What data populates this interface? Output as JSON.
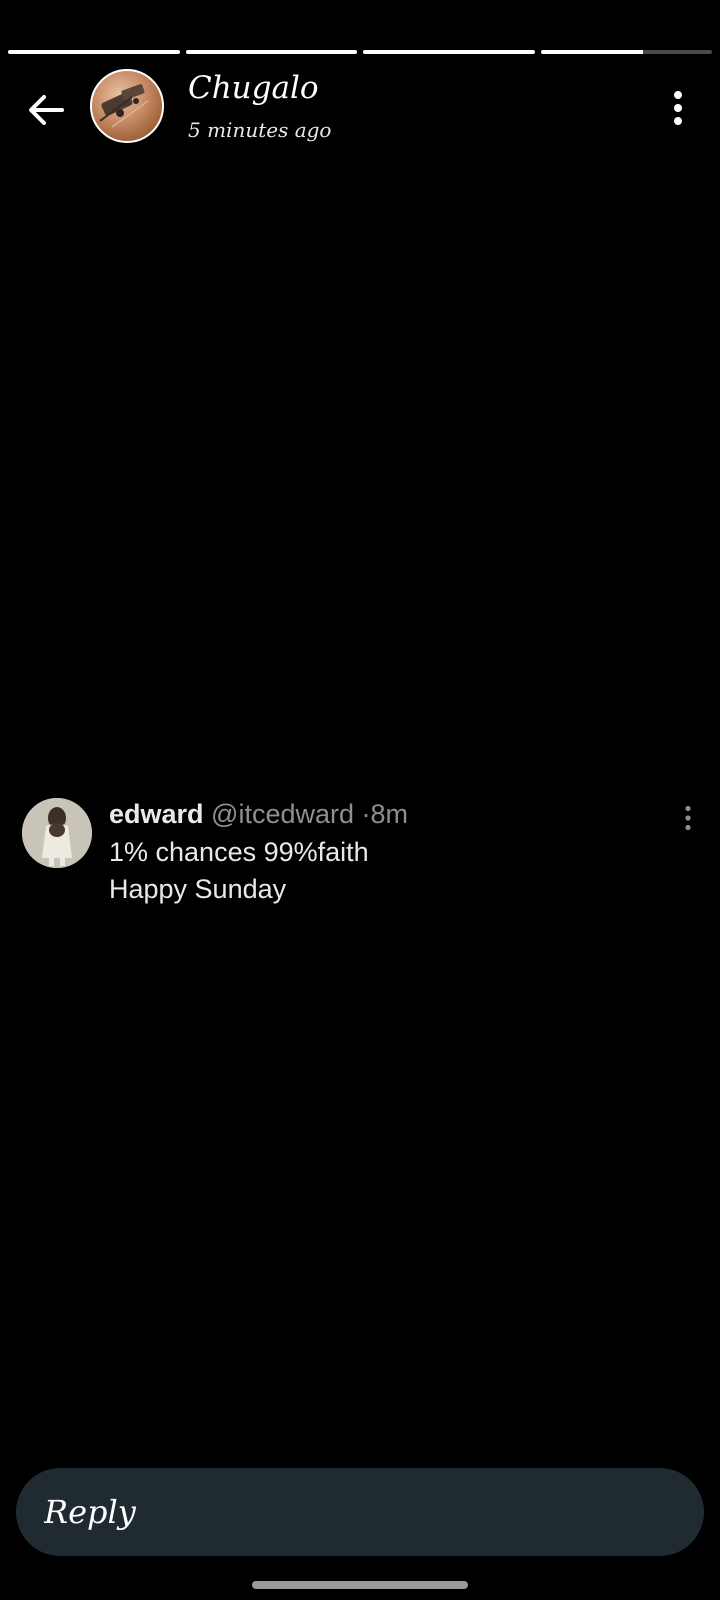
{
  "story": {
    "progress": [
      1.0,
      1.0,
      1.0,
      0.6
    ],
    "user_name": "Chugalo",
    "time_ago": "5 minutes ago"
  },
  "tweet": {
    "name": "edward",
    "handle": "@itcedward",
    "separator": "·",
    "age": "8m",
    "lines": [
      "1% chances 99%faith",
      "Happy Sunday"
    ]
  },
  "reply": {
    "placeholder": "Reply"
  },
  "icons": {
    "back": "arrow-left-icon",
    "story_menu": "more-vertical-icon",
    "tweet_menu": "more-vertical-icon"
  },
  "colors": {
    "background": "#000000",
    "reply_bar": "#202a31",
    "muted_text": "#8b9096",
    "primary_text": "#e7e9ea"
  }
}
